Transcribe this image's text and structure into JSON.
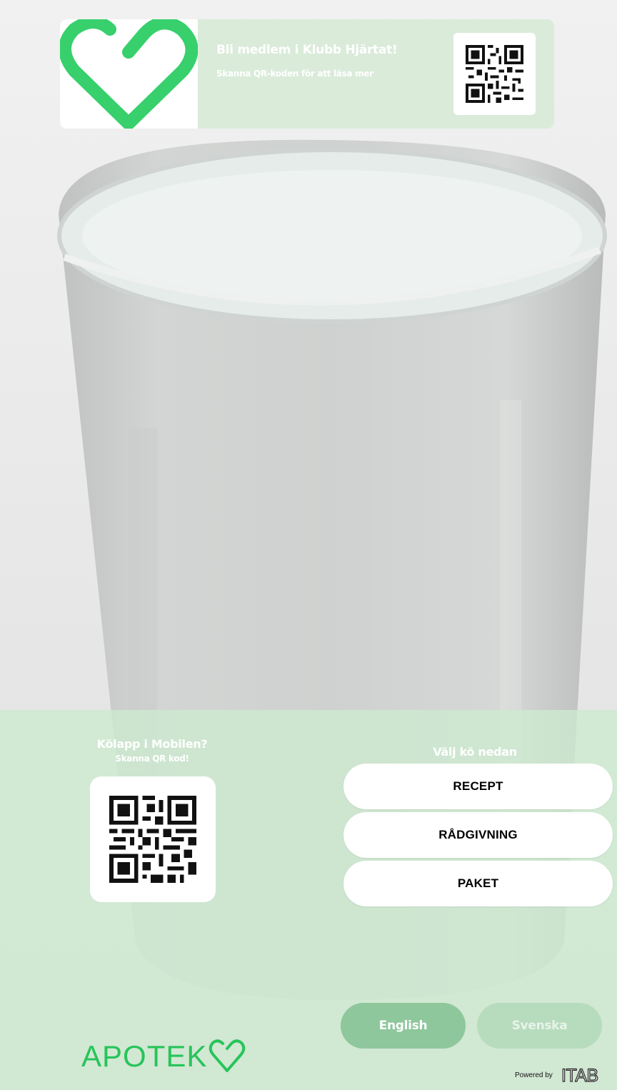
{
  "banner": {
    "title": "Bli medlem i Klubb Hjärtat!",
    "subtitle": "Skanna QR-koden för att läsa mer",
    "logo_icon": "heart-logo-icon",
    "qr_icon": "qr-code-icon"
  },
  "mobile_ticket": {
    "title": "Kölapp i Mobilen?",
    "subtitle": "Skanna QR kod!",
    "qr_icon": "qr-code-icon"
  },
  "queue": {
    "title": "Välj kö nedan",
    "buttons": [
      "RECEPT",
      "RÅDGIVNING",
      "PAKET"
    ]
  },
  "language": {
    "english": "English",
    "swedish": "Svenska"
  },
  "footer": {
    "brand": "APOTEK",
    "brand_icon": "heart-outline-icon",
    "powered_by": "Powered by",
    "itab": "ITAB"
  },
  "colors": {
    "brand_green": "#27c45a",
    "english_button": "#8ec79c",
    "swedish_button": "#b6dcbd",
    "panel": "#cdead0"
  }
}
